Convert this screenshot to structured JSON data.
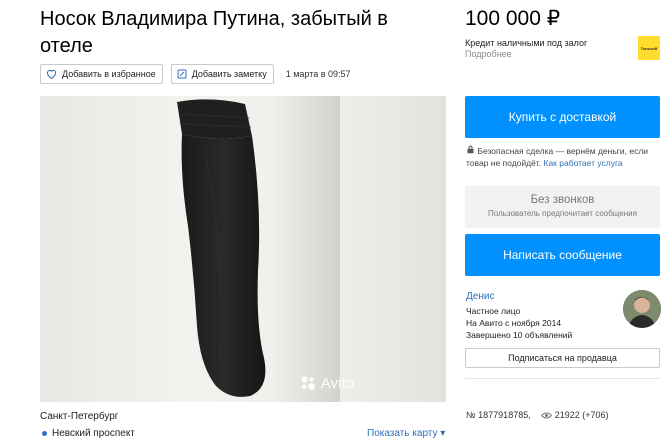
{
  "listing": {
    "title": "Носок Владимира Путина, забытый в отеле",
    "add_favorite_label": "Добавить в избранное",
    "add_note_label": "Добавить заметку",
    "date": "1 марта в 09:57",
    "photo_watermark": "Avito",
    "location_city": "Санкт-Петербург",
    "location_metro": "Невский проспект",
    "show_map_label": "Показать карту",
    "show_map_arrow": "▾"
  },
  "sidebar": {
    "price": "100 000 ₽",
    "credit_text": "Кредит наличными под залог",
    "credit_more": "Подробнее",
    "credit_logo": "Тинькоff",
    "buy_button": "Купить с доставкой",
    "safe_deal_text": "Безопасная сделка — вернём деньги, если товар не подойдёт.",
    "safe_deal_link": "Как работает услуга",
    "no_calls_title": "Без звонков",
    "no_calls_subtitle": "Пользователь предпочитает сообщения",
    "message_button": "Написать сообщение",
    "seller_name": "Денис",
    "seller_type": "Частное лицо",
    "seller_since": "На Авито с ноября 2014",
    "seller_completed": "Завершено 10 объявлений",
    "subscribe_button": "Подписаться на продавца",
    "listing_number": "№ 1877918785,",
    "views": "21922 (+706)"
  },
  "colors": {
    "accent": "#0091ff",
    "link": "#2f6fb8",
    "metro": "#2f6fc6"
  }
}
